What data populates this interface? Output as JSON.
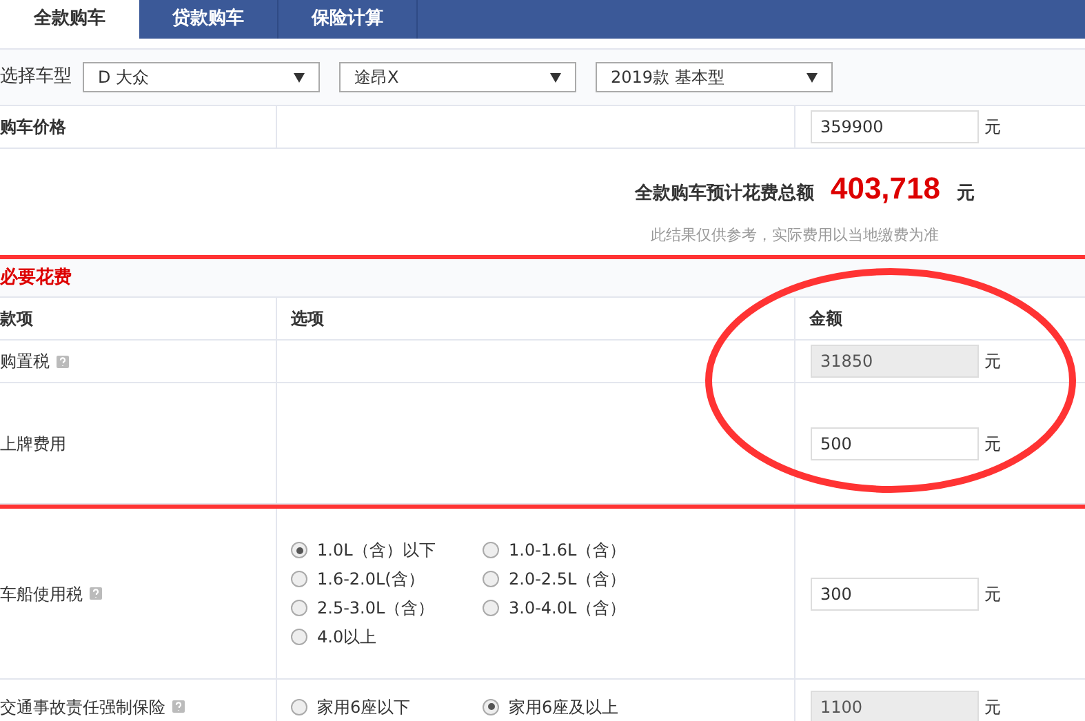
{
  "tabs": [
    {
      "label": "全款购车",
      "selected": true
    },
    {
      "label": "贷款购车",
      "selected": false
    },
    {
      "label": "保险计算",
      "selected": false
    }
  ],
  "model_selector": {
    "label": "选择车型",
    "selects": [
      "D 大众",
      "途昂X",
      "2019款 基本型"
    ]
  },
  "price": {
    "label": "购车价格",
    "value": "359900",
    "unit": "元"
  },
  "total": {
    "label": "全款购车预计花费总额",
    "amount": "403,718",
    "unit": "元",
    "note": "此结果仅供参考，实际费用以当地缴费为准"
  },
  "sections": [
    {
      "title": "必要花费",
      "columns": [
        "款项",
        "选项",
        "金额"
      ],
      "rows": [
        {
          "label": "购置税",
          "help": true,
          "value": "31850",
          "disabled": true,
          "unit": "元"
        },
        {
          "label": "上牌费用",
          "help": false,
          "value": "500",
          "disabled": false,
          "unit": "元"
        }
      ]
    },
    {
      "rows": [
        {
          "label": "车船使用税",
          "help": true,
          "options": [
            {
              "label": "1.0L（含）以下",
              "selected": true
            },
            {
              "label": "1.0-1.6L（含）",
              "selected": false
            },
            {
              "label": "1.6-2.0L(含）",
              "selected": false
            },
            {
              "label": "2.0-2.5L（含）",
              "selected": false
            },
            {
              "label": "2.5-3.0L（含）",
              "selected": false
            },
            {
              "label": "3.0-4.0L（含）",
              "selected": false
            },
            {
              "label": "4.0以上",
              "selected": false
            }
          ],
          "value": "300",
          "disabled": false,
          "unit": "元"
        },
        {
          "label": "交通事故责任强制保险",
          "help": true,
          "options": [
            {
              "label": "家用6座以下",
              "selected": false
            },
            {
              "label": "家用6座及以上",
              "selected": true
            }
          ],
          "value": "1100",
          "disabled": true,
          "unit": "元"
        }
      ]
    }
  ]
}
